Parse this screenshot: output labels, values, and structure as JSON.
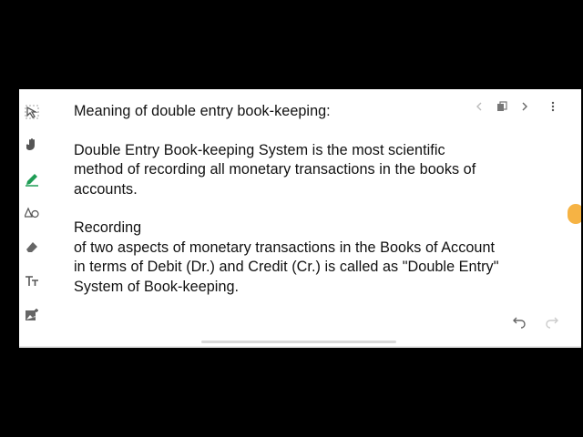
{
  "toolbar": {
    "tools": [
      {
        "name": "select-icon",
        "icon": "select"
      },
      {
        "name": "hand-icon",
        "icon": "hand"
      },
      {
        "name": "pen-icon",
        "icon": "pen",
        "color": "#1f9d55"
      },
      {
        "name": "shapes-icon",
        "icon": "shapes"
      },
      {
        "name": "eraser-icon",
        "icon": "eraser"
      },
      {
        "name": "text-icon",
        "icon": "text"
      },
      {
        "name": "image-icon",
        "icon": "image"
      }
    ]
  },
  "document": {
    "lines": [
      "Meaning of double entry book-keeping:",
      "",
      "Double Entry Book-keeping System is the most scientific",
      "method of recording all monetary transactions in the books of",
      "accounts.",
      "",
      "Recording",
      "of two aspects of monetary transactions in the Books of Account",
      "in terms of Debit (Dr.) and Credit (Cr.) is called as \"Double Entry\"",
      "System of Book-keeping."
    ]
  },
  "nav": {
    "prev": "chevron-left-icon",
    "copy": "copy-icon",
    "next": "chevron-right-icon",
    "more": "more-vertical-icon"
  },
  "history": {
    "undo": "undo-icon",
    "redo": "redo-icon"
  },
  "colors": {
    "accent": "#f5a623",
    "pen": "#1f9d55"
  }
}
